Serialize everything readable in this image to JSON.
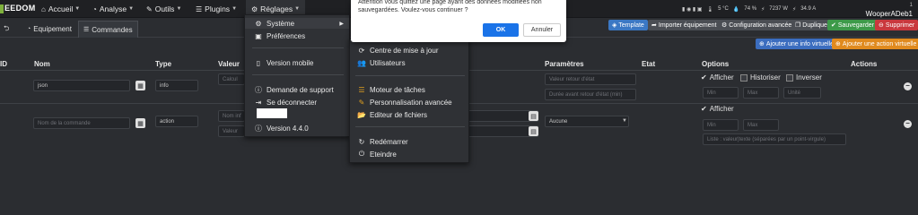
{
  "navbar": {
    "logo": "EEDOM",
    "items": [
      {
        "label": "Accueil",
        "icon": "home-icon"
      },
      {
        "label": "Analyse",
        "icon": "tachometer-icon"
      },
      {
        "label": "Outils",
        "icon": "wrench-icon"
      },
      {
        "label": "Plugins",
        "icon": "tasks-icon"
      },
      {
        "label": "Réglages",
        "icon": "cogs-icon"
      }
    ],
    "status": [
      "5 °C",
      "74 %",
      "7237 W",
      "34.9 A"
    ],
    "user": "WooperADeb1",
    "user_top": "1"
  },
  "tabs": {
    "back": "⮌",
    "equipment": "Equipement",
    "commands": "Commandes"
  },
  "actions": {
    "template": "Template",
    "import": "Importer équipement",
    "config": "Configuration avancée",
    "duplicate": "Dupliquer",
    "save": "Sauvegarder",
    "delete": "Supprimer",
    "add_info": "Ajouter une info virtuelle",
    "add_action": "Ajouter une action virtuelle"
  },
  "table": {
    "headers": [
      "ID",
      "Nom",
      "Type",
      "Valeur",
      "Paramètres",
      "Etat",
      "Options",
      "Actions"
    ],
    "rows": [
      {
        "name": "json",
        "type": "info",
        "value_placeholder": "Calcul",
        "param_1": "Valeur retour d'état",
        "param_2": "Durée avant retour d'état (min)",
        "options": {
          "show": "Afficher",
          "history": "Historiser",
          "invert": "Inverser",
          "min": "Min",
          "max": "Max",
          "unit": "Unité"
        }
      },
      {
        "name_placeholder": "Nom de la commande",
        "type": "action",
        "value_placeholder_1": "Nom inf",
        "value_placeholder_2": "Valeur",
        "select": "Aucune",
        "options": {
          "show": "Afficher",
          "min": "Min",
          "max": "Max",
          "list": "Liste : valeur|texte (séparées par un point-virgule)"
        }
      }
    ]
  },
  "menu_reglages": {
    "items": [
      "Système",
      "Préférences",
      "Version mobile",
      "Demande de support",
      "Se déconnecter",
      "Version 4.4.0"
    ]
  },
  "menu_systeme": {
    "items": [
      "Centre de mise à jour",
      "Utilisateurs",
      "Moteur de tâches",
      "Personnalisation avancée",
      "Editeur de fichiers",
      "Redémarrer",
      "Eteindre"
    ]
  },
  "modal": {
    "message": "Attention vous quittez une page ayant des données modifiées non sauvegardées. Voulez-vous continuer ?",
    "ok": "OK",
    "cancel": "Annuler"
  }
}
